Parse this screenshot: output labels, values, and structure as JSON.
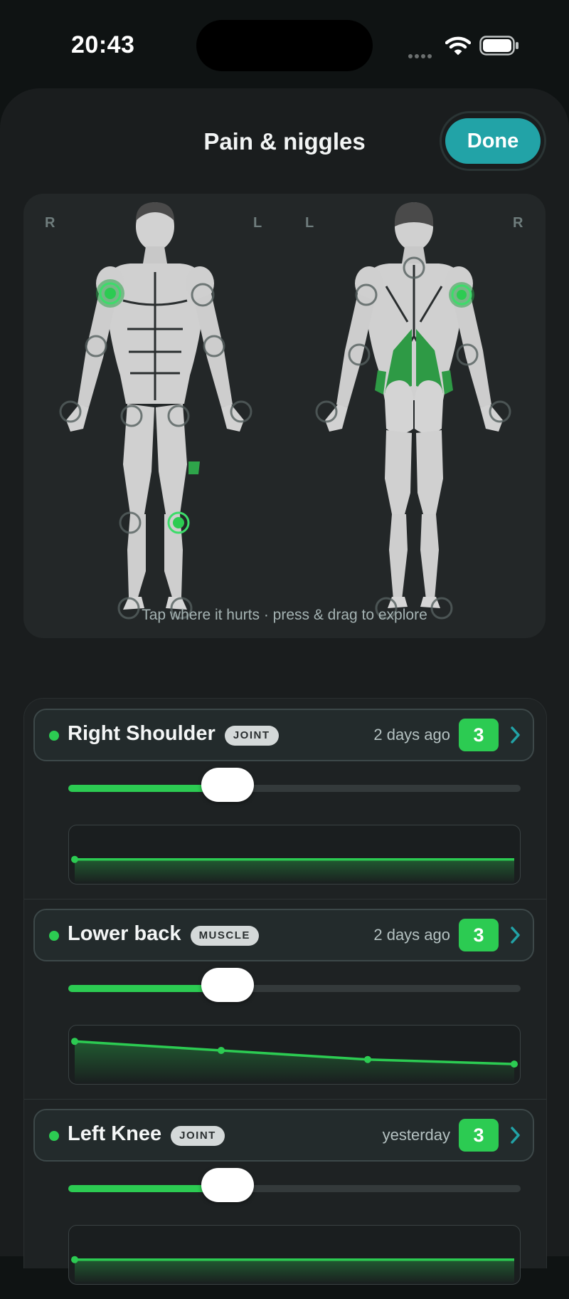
{
  "status_bar": {
    "time": "20:43"
  },
  "sheet": {
    "title": "Pain & niggles",
    "done_label": "Done"
  },
  "body_map": {
    "front_left_label": "R",
    "front_right_label": "L",
    "back_left_label": "L",
    "back_right_label": "R",
    "hint": "Tap where it hurts · press & drag to explore"
  },
  "colors": {
    "accent": "#2ccb52",
    "done_button": "#22a3a7",
    "background": "#1a1d1e"
  },
  "entries": [
    {
      "name": "Right Shoulder",
      "type": "JOINT",
      "when": "2 days ago",
      "score": "3",
      "level": 0.3,
      "trend": [
        3,
        3
      ]
    },
    {
      "name": "Lower back",
      "type": "MUSCLE",
      "when": "2 days ago",
      "score": "3",
      "level": 0.3,
      "trend": [
        5,
        4,
        3,
        2.5
      ]
    },
    {
      "name": "Left Knee",
      "type": "JOINT",
      "when": "yesterday",
      "score": "3",
      "level": 0.3,
      "trend": [
        3,
        3
      ]
    }
  ]
}
